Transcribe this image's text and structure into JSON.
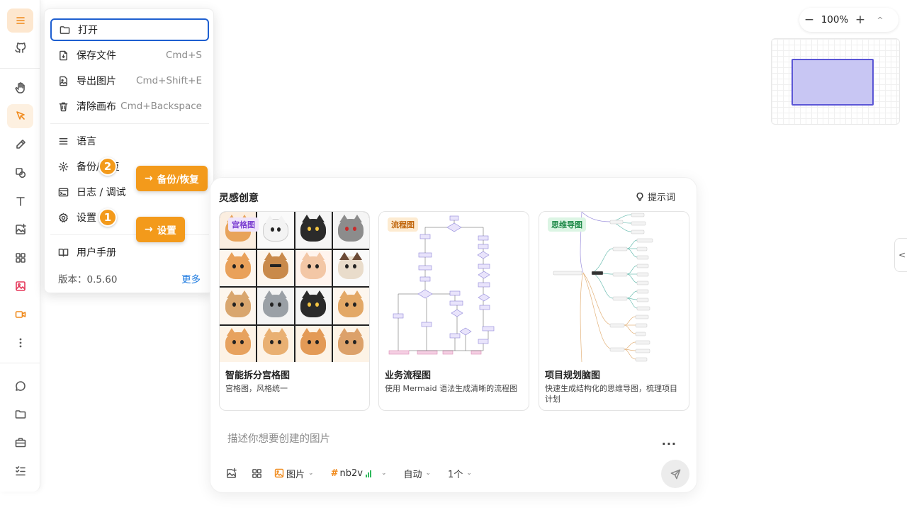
{
  "toolbar": {
    "items": [
      "menu-icon",
      "github-icon",
      "hand-icon",
      "pointer-icon",
      "pencil-icon",
      "shapes-icon",
      "text-icon",
      "image-add-icon",
      "grid-icon",
      "image-icon",
      "video-icon",
      "more-vertical-icon",
      "chat-icon",
      "folder-icon",
      "briefcase-icon",
      "checklist-icon"
    ],
    "accent_color": "#f08a1c"
  },
  "menu": {
    "items": [
      {
        "label": "打开",
        "shortcut": "",
        "icon": "folder-icon"
      },
      {
        "label": "保存文件",
        "shortcut": "Cmd+S",
        "icon": "save-file-icon"
      },
      {
        "label": "导出图片",
        "shortcut": "Cmd+Shift+E",
        "icon": "export-image-icon"
      },
      {
        "label": "清除画布",
        "shortcut": "Cmd+Backspace",
        "icon": "trash-icon"
      },
      {
        "label": "语言",
        "shortcut": "",
        "icon": "language-icon"
      },
      {
        "label": "备份/恢复",
        "shortcut": "",
        "icon": "backup-icon"
      },
      {
        "label": "日志 / 调试",
        "shortcut": "",
        "icon": "log-icon"
      },
      {
        "label": "设置",
        "shortcut": "",
        "icon": "gear-icon"
      },
      {
        "label": "用户手册",
        "shortcut": "",
        "icon": "book-icon"
      }
    ],
    "version_label": "版本：0.5.60",
    "more_link": "更多"
  },
  "callouts": {
    "backup_badge": "2",
    "backup_label": "备份/恢复",
    "settings_badge": "1",
    "settings_label": "设置",
    "arrow": "→"
  },
  "zoom": {
    "minus": "−",
    "value": "100%",
    "plus": "+",
    "collapse": "^"
  },
  "right_tab": {
    "icon": "chevron-left-icon",
    "glyph": "<"
  },
  "inspiration": {
    "title": "灵感创意",
    "tip_button": "提示词",
    "cards": [
      {
        "tag": "宫格图",
        "tag_bg": "#efe4fb",
        "tag_color": "#7b3fd1",
        "title": "智能拆分宫格图",
        "desc": "宫格图，风格统一"
      },
      {
        "tag": "流程图",
        "tag_bg": "#fdebd1",
        "tag_color": "#c0650a",
        "title": "业务流程图",
        "desc": "使用 Mermaid 语法生成清晰的流程图"
      },
      {
        "tag": "思维导图",
        "tag_bg": "#dcf5e4",
        "tag_color": "#1f8a49",
        "title": "项目规划脑图",
        "desc": "快速生成结构化的思维导图，梳理项目计划"
      }
    ],
    "prompt_placeholder": "描述你想要创建的图片",
    "more_dots": "...",
    "options": {
      "image_type": "图片",
      "model_hash": "#",
      "model": "nb2v",
      "mode": "自动",
      "count": "1个",
      "caret": "⌄"
    }
  }
}
